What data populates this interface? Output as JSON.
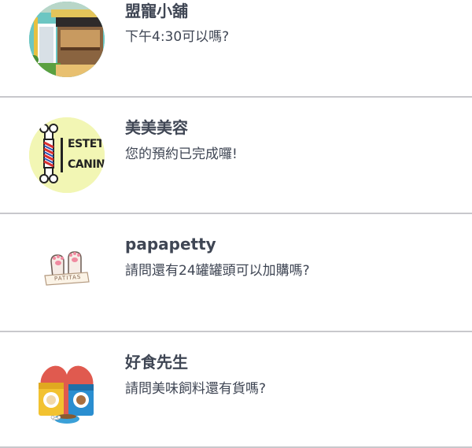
{
  "conversations": [
    {
      "name": "盟寵小舖",
      "message": "下午4:30可以嗎?",
      "avatar_icon": "pet-shop-storefront-icon"
    },
    {
      "name": "美美美容",
      "message": "您的預約已完成囉!",
      "avatar_icon": "barber-pole-icon",
      "avatar_text": [
        "ESTETIC",
        "CANINA"
      ]
    },
    {
      "name": "papapetty",
      "message": "請問還有24罐罐頭可以加購嗎?",
      "avatar_icon": "paws-icon",
      "avatar_text": [
        "PATITAS"
      ]
    },
    {
      "name": "好食先生",
      "message": "請問美味飼料還有貨嗎?",
      "avatar_icon": "pet-food-bags-icon"
    }
  ],
  "colors": {
    "text": "#3f4654",
    "divider": "#c8c8cc",
    "store_teal": "#6cc6c2",
    "estetica_bg": "#f2f6b4",
    "food_heart": "#e05a4f"
  }
}
